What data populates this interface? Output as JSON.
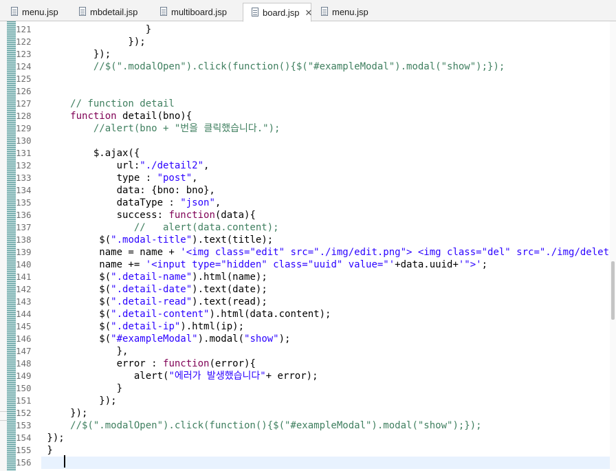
{
  "tabs": [
    {
      "label": "menu.jsp",
      "active": false
    },
    {
      "label": "mbdetail.jsp",
      "active": false
    },
    {
      "label": "multiboard.jsp",
      "active": false
    },
    {
      "label": "board.jsp",
      "active": true,
      "close": "✕"
    },
    {
      "label": "menu.jsp",
      "active": false
    }
  ],
  "colors": {
    "keyword": "#7f0055",
    "string": "#2a00ff",
    "comment": "#3f7f5f",
    "current_line": "#e8f2fe"
  },
  "editor": {
    "current_line": "156",
    "lines": [
      {
        "num": "121",
        "segs": [
          {
            "t": "                  }",
            "c": ""
          }
        ]
      },
      {
        "num": "122",
        "segs": [
          {
            "t": "               });",
            "c": ""
          }
        ]
      },
      {
        "num": "123",
        "segs": [
          {
            "t": "         });",
            "c": ""
          }
        ]
      },
      {
        "num": "124",
        "segs": [
          {
            "t": "         //$(\".modalOpen\").click(function(){$(\"#exampleModal\").modal(\"show\");});",
            "c": "c"
          }
        ]
      },
      {
        "num": "125",
        "segs": []
      },
      {
        "num": "126",
        "segs": []
      },
      {
        "num": "127",
        "segs": [
          {
            "t": "     // function detail",
            "c": "c"
          }
        ]
      },
      {
        "num": "128",
        "segs": [
          {
            "t": "     ",
            "c": ""
          },
          {
            "t": "function",
            "c": "k"
          },
          {
            "t": " detail(bno){",
            "c": ""
          }
        ]
      },
      {
        "num": "129",
        "segs": [
          {
            "t": "         //alert(bno + \"번을 클릭했습니다.\");",
            "c": "c"
          }
        ]
      },
      {
        "num": "130",
        "segs": []
      },
      {
        "num": "131",
        "segs": [
          {
            "t": "         $.ajax({",
            "c": ""
          }
        ]
      },
      {
        "num": "132",
        "segs": [
          {
            "t": "             url:",
            "c": ""
          },
          {
            "t": "\"./detail2\"",
            "c": "s"
          },
          {
            "t": ",",
            "c": ""
          }
        ]
      },
      {
        "num": "133",
        "segs": [
          {
            "t": "             type : ",
            "c": ""
          },
          {
            "t": "\"post\"",
            "c": "s"
          },
          {
            "t": ",",
            "c": ""
          }
        ]
      },
      {
        "num": "134",
        "segs": [
          {
            "t": "             data: {bno: bno},",
            "c": ""
          }
        ]
      },
      {
        "num": "135",
        "segs": [
          {
            "t": "             dataType : ",
            "c": ""
          },
          {
            "t": "\"json\"",
            "c": "s"
          },
          {
            "t": ",",
            "c": ""
          }
        ]
      },
      {
        "num": "136",
        "segs": [
          {
            "t": "             success: ",
            "c": ""
          },
          {
            "t": "function",
            "c": "k"
          },
          {
            "t": "(data){",
            "c": ""
          }
        ]
      },
      {
        "num": "137",
        "segs": [
          {
            "t": "                //   alert(data.content);",
            "c": "c"
          }
        ]
      },
      {
        "num": "138",
        "segs": [
          {
            "t": "          $(",
            "c": ""
          },
          {
            "t": "\".modal-title\"",
            "c": "s"
          },
          {
            "t": ").text(title);",
            "c": ""
          }
        ]
      },
      {
        "num": "139",
        "segs": [
          {
            "t": "          name = name + ",
            "c": ""
          },
          {
            "t": "'<img class=\"edit\" src=\"./img/edit.png\"> <img class=\"del\" src=\"./img/delete.png\">'",
            "c": "s"
          }
        ]
      },
      {
        "num": "140",
        "segs": [
          {
            "t": "          name += ",
            "c": ""
          },
          {
            "t": "'<input type=\"hidden\" class=\"uuid\" value=\"'",
            "c": "s"
          },
          {
            "t": "+data.uuid+",
            "c": ""
          },
          {
            "t": "'\">'",
            "c": "s"
          },
          {
            "t": ";",
            "c": ""
          }
        ]
      },
      {
        "num": "141",
        "segs": [
          {
            "t": "          $(",
            "c": ""
          },
          {
            "t": "\".detail-name\"",
            "c": "s"
          },
          {
            "t": ").html(name);",
            "c": ""
          }
        ]
      },
      {
        "num": "142",
        "segs": [
          {
            "t": "          $(",
            "c": ""
          },
          {
            "t": "\".detail-date\"",
            "c": "s"
          },
          {
            "t": ").text(date);",
            "c": ""
          }
        ]
      },
      {
        "num": "143",
        "segs": [
          {
            "t": "          $(",
            "c": ""
          },
          {
            "t": "\".detail-read\"",
            "c": "s"
          },
          {
            "t": ").text(read);",
            "c": ""
          }
        ]
      },
      {
        "num": "144",
        "segs": [
          {
            "t": "          $(",
            "c": ""
          },
          {
            "t": "\".detail-content\"",
            "c": "s"
          },
          {
            "t": ").html(data.content);",
            "c": ""
          }
        ]
      },
      {
        "num": "145",
        "segs": [
          {
            "t": "          $(",
            "c": ""
          },
          {
            "t": "\".detail-ip\"",
            "c": "s"
          },
          {
            "t": ").html(ip);",
            "c": ""
          }
        ]
      },
      {
        "num": "146",
        "segs": [
          {
            "t": "          $(",
            "c": ""
          },
          {
            "t": "\"#exampleModal\"",
            "c": "s"
          },
          {
            "t": ").modal(",
            "c": ""
          },
          {
            "t": "\"show\"",
            "c": "s"
          },
          {
            "t": ");",
            "c": ""
          }
        ]
      },
      {
        "num": "147",
        "segs": [
          {
            "t": "             },",
            "c": ""
          }
        ]
      },
      {
        "num": "148",
        "segs": [
          {
            "t": "             error : ",
            "c": ""
          },
          {
            "t": "function",
            "c": "k"
          },
          {
            "t": "(error){",
            "c": ""
          }
        ]
      },
      {
        "num": "149",
        "segs": [
          {
            "t": "                alert(",
            "c": ""
          },
          {
            "t": "\"에러가 발생했습니다\"",
            "c": "s"
          },
          {
            "t": "+ error);",
            "c": ""
          }
        ]
      },
      {
        "num": "150",
        "segs": [
          {
            "t": "             }",
            "c": ""
          }
        ]
      },
      {
        "num": "151",
        "segs": [
          {
            "t": "          });",
            "c": ""
          }
        ]
      },
      {
        "num": "152",
        "segs": [
          {
            "t": "     });",
            "c": ""
          }
        ]
      },
      {
        "num": "153",
        "segs": [
          {
            "t": "     //$(\".modalOpen\").click(function(){$(\"#exampleModal\").modal(\"show\");});",
            "c": "c"
          }
        ]
      },
      {
        "num": "154",
        "segs": [
          {
            "t": " });",
            "c": ""
          }
        ]
      },
      {
        "num": "155",
        "segs": [
          {
            "t": " }",
            "c": ""
          }
        ]
      },
      {
        "num": "156",
        "segs": []
      }
    ]
  }
}
